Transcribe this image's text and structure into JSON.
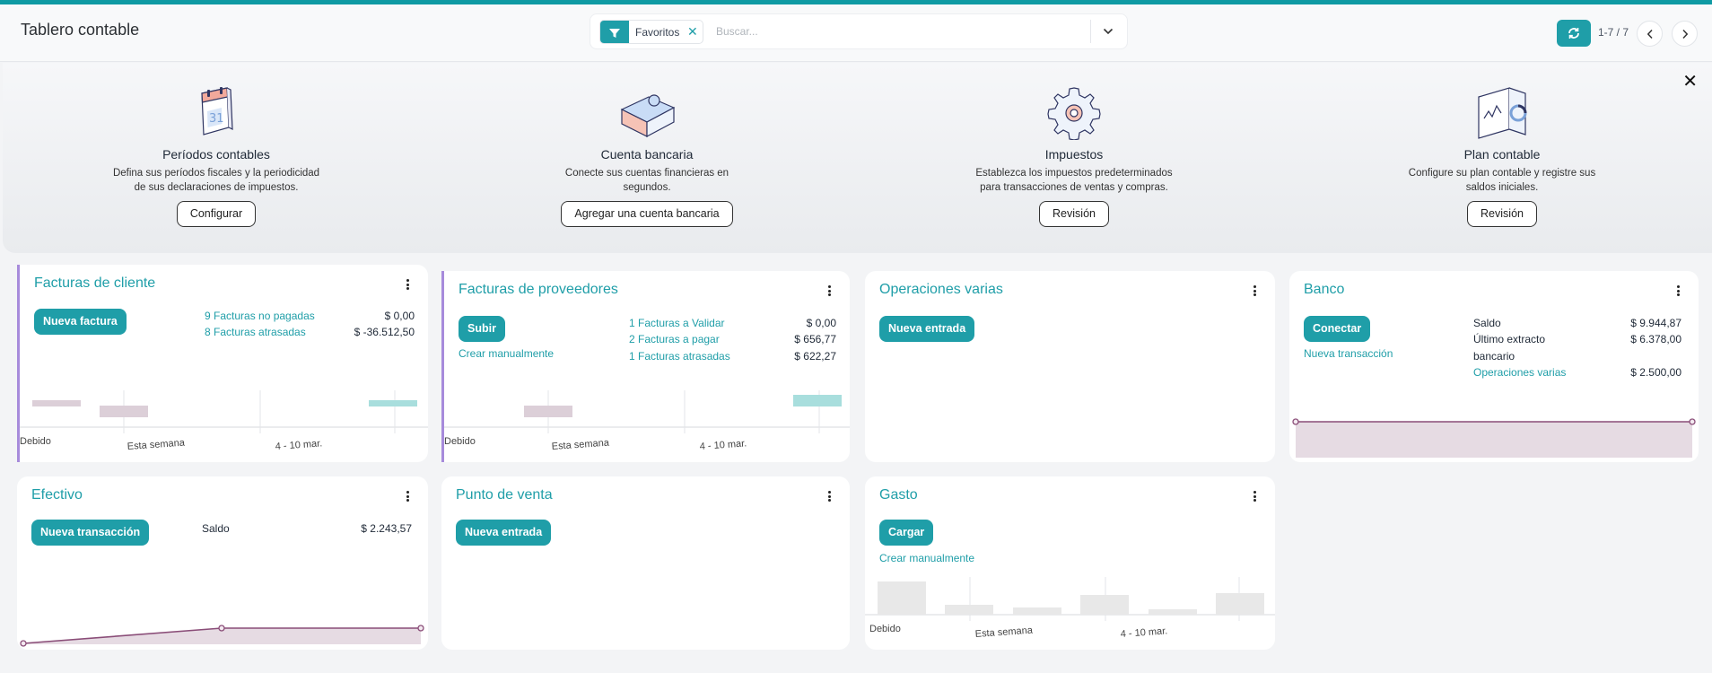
{
  "header": {
    "title": "Tablero contable",
    "search": {
      "facet_label": "Favoritos",
      "placeholder": "Buscar..."
    },
    "pager": {
      "value": "1-7 / 7"
    }
  },
  "onboarding": {
    "steps": [
      {
        "title": "Períodos contables",
        "desc_line1": "Defina sus períodos fiscales y la periodicidad",
        "desc_line2": "de sus declaraciones de impuestos.",
        "button": "Configurar"
      },
      {
        "title": "Cuenta bancaria",
        "desc_line1": "Conecte sus cuentas financieras en",
        "desc_line2": "segundos.",
        "button": "Agregar una cuenta bancaria"
      },
      {
        "title": "Impuestos",
        "desc_line1": "Establezca los impuestos predeterminados",
        "desc_line2": "para transacciones de ventas y compras.",
        "button": "Revisión"
      },
      {
        "title": "Plan contable",
        "desc_line1": "Configure su plan contable y registre sus",
        "desc_line2": "saldos iniciales.",
        "button": "Revisión"
      }
    ]
  },
  "cards": {
    "customer_invoices": {
      "title": "Facturas de cliente",
      "button": "Nueva factura",
      "rows": [
        {
          "label": "9 Facturas no pagadas",
          "value": "$ 0,00"
        },
        {
          "label": "8 Facturas atrasadas",
          "value": "$ -36.512,50"
        }
      ],
      "chart_labels": [
        "Debido",
        "Esta semana",
        "4 - 10 mar."
      ]
    },
    "vendor_bills": {
      "title": "Facturas de proveedores",
      "button": "Subir",
      "link": "Crear manualmente",
      "rows": [
        {
          "label": "1 Facturas a Validar",
          "value": "$ 0,00"
        },
        {
          "label": "2 Facturas a pagar",
          "value": "$ 656,77"
        },
        {
          "label": "1 Facturas atrasadas",
          "value": "$ 622,27"
        }
      ],
      "chart_labels": [
        "Debido",
        "Esta semana",
        "4 - 10 mar."
      ]
    },
    "misc": {
      "title": "Operaciones varias",
      "button": "Nueva entrada"
    },
    "bank": {
      "title": "Banco",
      "button": "Conectar",
      "link": "Nueva transacción",
      "saldo_label": "Saldo",
      "saldo_value": "$ 9.944,87",
      "extracto_label_1": "Último extracto",
      "extracto_label_2": "bancario",
      "extracto_value": "$ 6.378,00",
      "ops_label": "Operaciones varias",
      "ops_value": "$ 2.500,00"
    },
    "cash": {
      "title": "Efectivo",
      "button": "Nueva transacción",
      "saldo_label": "Saldo",
      "saldo_value": "$ 2.243,57"
    },
    "pos": {
      "title": "Punto de venta",
      "button": "Nueva entrada"
    },
    "expense": {
      "title": "Gasto",
      "button": "Cargar",
      "link": "Crear manualmente",
      "chart_labels": [
        "Debido",
        "Esta semana",
        "4 - 10 mar."
      ]
    }
  },
  "colors": {
    "accent": "#1f9ea8",
    "card_accent": "#a78bdb",
    "graph_line": "#8a4d78",
    "graph_fill": "#e6dbe3"
  }
}
